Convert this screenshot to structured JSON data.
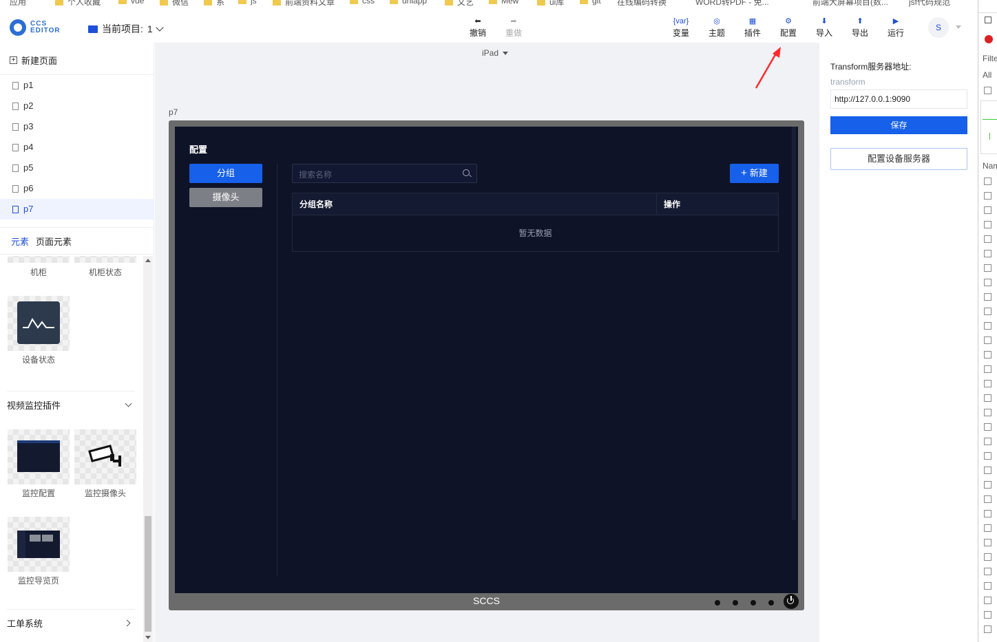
{
  "bookmarks": [
    "应用",
    "个人收藏",
    "vue",
    "微信",
    "系",
    "js",
    "前端资料文章",
    "css",
    "uniapp",
    "文艺",
    "Mew",
    "ui库",
    "git",
    "在线编码转换",
    "WORD转PDF - 免...",
    "前端大屏幕项目(数...",
    "jsf代码规范"
  ],
  "header": {
    "logo_line1": "CCS",
    "logo_line2": "EDITOR",
    "project_label": "当前项目:",
    "project_value": "1",
    "toolbar": {
      "undo": "撤销",
      "redo": "重做",
      "variable": "变量",
      "theme": "主题",
      "plugin": "插件",
      "config": "配置",
      "import": "导入",
      "export": "导出",
      "run": "运行"
    },
    "avatar": "S"
  },
  "sidebar": {
    "new_page": "新建页面",
    "pages": [
      "p1",
      "p2",
      "p3",
      "p4",
      "p5",
      "p6",
      "p7"
    ],
    "active_page": "p7",
    "tabs": {
      "elements": "元素",
      "page_elements": "页面元素"
    },
    "items": {
      "cabinet": "机柜",
      "cabinet_status": "机柜状态",
      "device_status": "设备状态",
      "monitor_config": "监控配置",
      "monitor_camera": "监控摄像头",
      "monitor_nav": "监控导览页"
    },
    "sections": {
      "video": "视频监控插件",
      "ticket": "工单系统"
    }
  },
  "canvas": {
    "device": "iPad",
    "page_name": "p7",
    "screen": {
      "title": "配置",
      "btn_group": "分组",
      "btn_camera": "摄像头",
      "search_placeholder": "搜索名称",
      "btn_new": "新建",
      "col_name": "分组名称",
      "col_action": "操作",
      "empty": "暂无数据"
    },
    "brand": "SCCS"
  },
  "right_panel": {
    "title": "Transform服务器地址:",
    "sub": "transform",
    "url_value": "http://127.0.0.1:9090",
    "save": "保存",
    "config_server": "配置设备服务器"
  },
  "devtools": {
    "filter": "Filte",
    "all": "All",
    "name": "Nam"
  },
  "colors": {
    "accent": "#1660ea",
    "screen_bg": "#0e1327",
    "annotation_arrow": "#ff2a2a"
  }
}
